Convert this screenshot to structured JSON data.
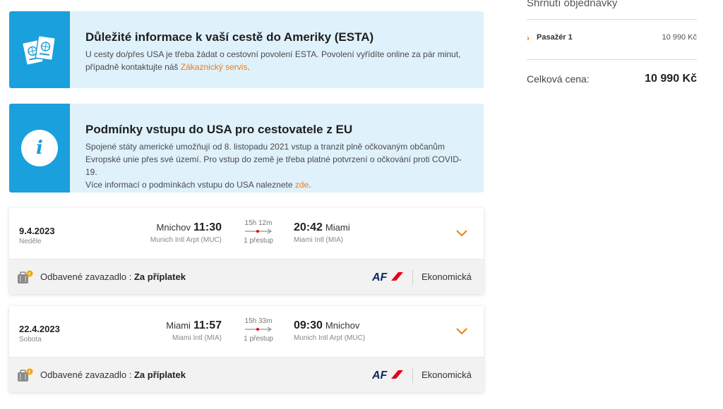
{
  "summary": {
    "title": "Shrnutí objednávky",
    "passenger_label": "Pasažér 1",
    "passenger_price": "10 990 Kč",
    "total_label": "Celková cena:",
    "total_value": "10 990 Kč"
  },
  "notices": [
    {
      "title": "Důležité informace k vaší cestě do Ameriky (ESTA)",
      "text_line1": "U cesty do/přes USA je třeba žádat o cestovní povolení ESTA. Povolení vyřídíte online za pár minut,",
      "text_line2": "případně kontaktujte náš ",
      "link": "Zákaznický servis",
      "text_end": ".",
      "icon": "passports-icon"
    },
    {
      "title": "Podmínky vstupu do USA pro cestovatele z EU",
      "text_line1": "Spojené státy americké umožňují od 8. listopadu 2021 vstup a tranzit plně očkovaným občanům",
      "text_line2": "Evropské unie přes své území. Pro vstup do země je třeba platné potvrzení o očkování proti COVID-19.",
      "text_line3": "Více informací o podmínkách vstupu do USA naleznete ",
      "link": "zde",
      "text_end": ".",
      "icon": "info-icon"
    }
  ],
  "flights": [
    {
      "date": "9.4.2023",
      "day": "Neděle",
      "dep_city": "Mnichov",
      "dep_time": "11:30",
      "dep_airport": "Munich Intl Arpt (MUC)",
      "duration": "15h 12m",
      "stops": "1 přestup",
      "arr_time": "20:42",
      "arr_city": "Miami",
      "arr_airport": "Miami Intl (MIA)",
      "baggage_label": "Odbavené zavazadlo : ",
      "baggage_value": "Za příplatek",
      "airline": "AF",
      "cabin": "Ekonomická"
    },
    {
      "date": "22.4.2023",
      "day": "Sobota",
      "dep_city": "Miami",
      "dep_time": "11:57",
      "dep_airport": "Miami Intl (MIA)",
      "duration": "15h 33m",
      "stops": "1 přestup",
      "arr_time": "09:30",
      "arr_city": "Mnichov",
      "arr_airport": "Munich Intl Arpt (MUC)",
      "baggage_label": "Odbavené zavazadlo : ",
      "baggage_value": "Za příplatek",
      "airline": "AF",
      "cabin": "Ekonomická"
    }
  ],
  "colors": {
    "accent": "#f07b14",
    "info_blue": "#1aa0dc",
    "info_bg": "#dff1fb",
    "af_navy": "#0b2a5e",
    "af_red": "#e3001b"
  }
}
